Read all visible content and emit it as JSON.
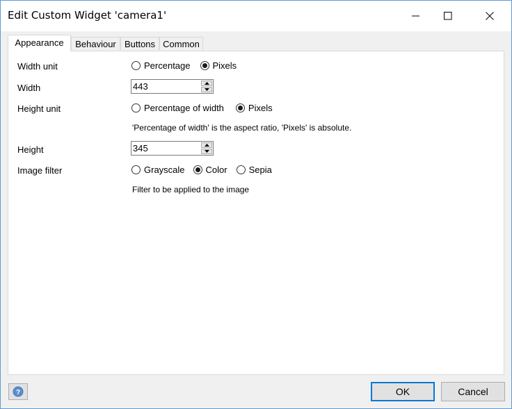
{
  "window": {
    "title": "Edit Custom Widget 'camera1'",
    "controls": {
      "minimize_icon": "minimize-icon",
      "maximize_icon": "maximize-icon",
      "close_icon": "close-icon"
    }
  },
  "tabs": [
    {
      "label": "Appearance",
      "active": true
    },
    {
      "label": "Behaviour",
      "active": false
    },
    {
      "label": "Buttons",
      "active": false
    },
    {
      "label": "Common",
      "active": false
    }
  ],
  "form": {
    "width_unit": {
      "label": "Width unit",
      "options": [
        "Percentage",
        "Pixels"
      ],
      "selected": "Pixels"
    },
    "width": {
      "label": "Width",
      "value": "443"
    },
    "height_unit": {
      "label": "Height unit",
      "options": [
        "Percentage of width",
        "Pixels"
      ],
      "selected": "Pixels",
      "hint": "'Percentage of width' is the aspect ratio, 'Pixels' is absolute."
    },
    "height": {
      "label": "Height",
      "value": "345"
    },
    "image_filter": {
      "label": "Image filter",
      "options": [
        "Grayscale",
        "Color",
        "Sepia"
      ],
      "selected": "Color",
      "hint": "Filter to be applied to the image"
    }
  },
  "footer": {
    "help_icon": "help-icon",
    "ok_label": "OK",
    "cancel_label": "Cancel"
  },
  "colors": {
    "window_border": "#5b9bd5",
    "ok_border": "#0078d7",
    "help_icon": "#4a7fc1"
  }
}
